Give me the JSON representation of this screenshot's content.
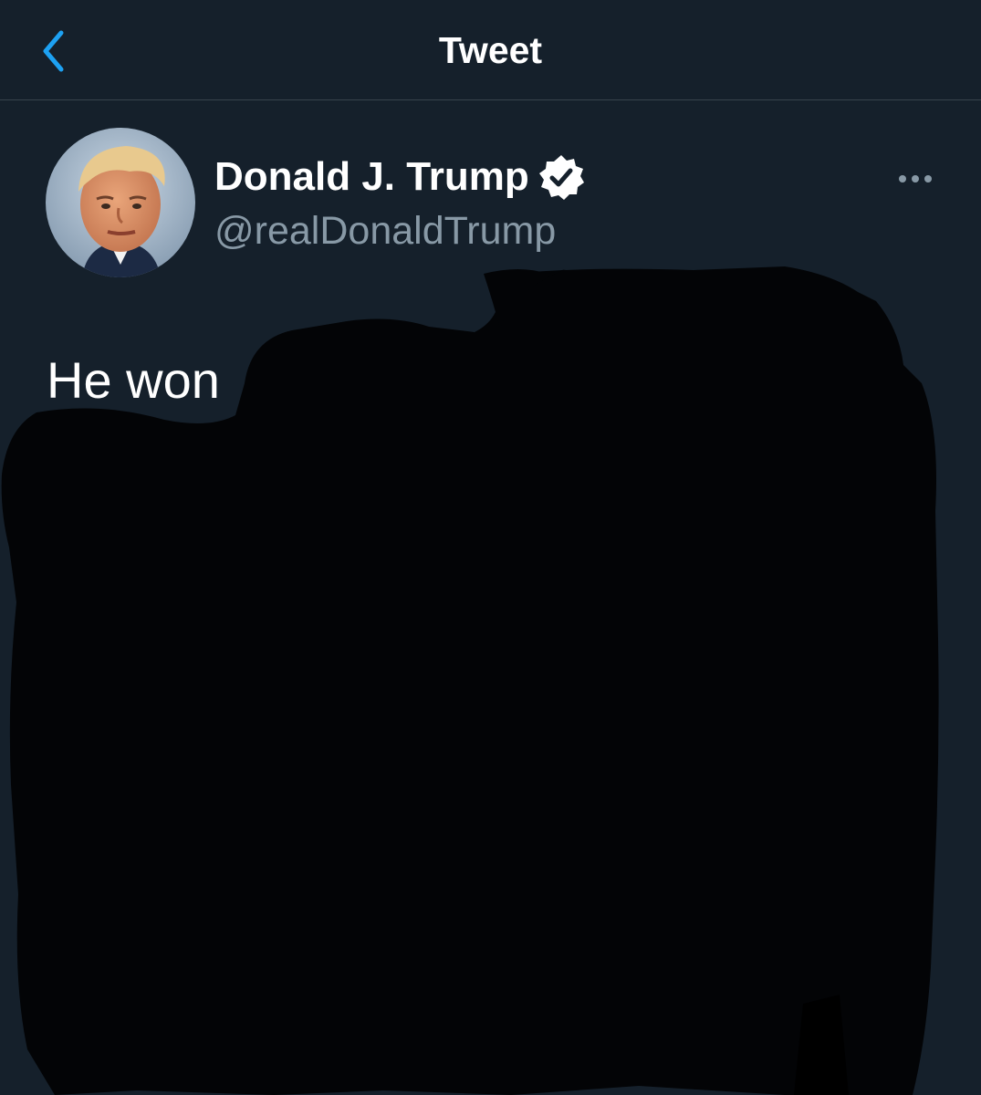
{
  "nav": {
    "title": "Tweet",
    "back_icon": "chevron-left-icon"
  },
  "tweet": {
    "author": {
      "display_name": "Donald J. Trump",
      "handle": "@realDonaldTrump",
      "verified": true,
      "avatar_icon": "profile-photo"
    },
    "text_visible": "He won",
    "more_icon": "ellipsis-icon",
    "redacted": true
  },
  "colors": {
    "background": "#15202b",
    "accent": "#1da1f2",
    "text": "#ffffff",
    "secondary_text": "#8899a6",
    "divider": "#38444d",
    "redaction": "#030406"
  }
}
